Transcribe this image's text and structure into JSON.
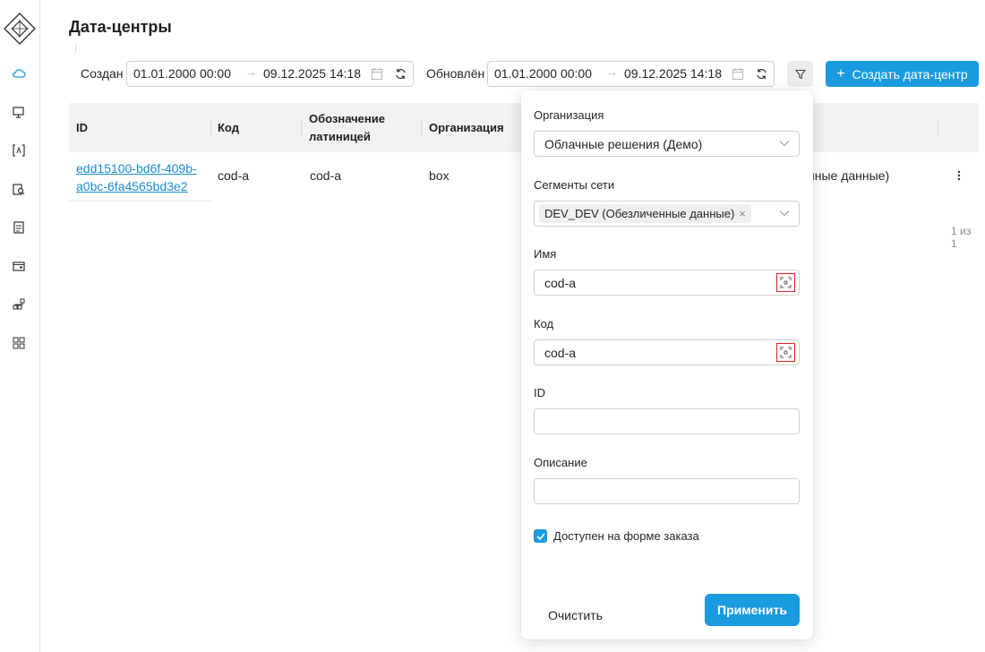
{
  "page": {
    "title": "Дата-центры"
  },
  "sidebar": {
    "icons": [
      "app-logo",
      "cloud-icon",
      "monitor-icon",
      "bracket-icon",
      "clipboard-search-icon",
      "list-icon",
      "wallet-icon",
      "hierarchy-icon",
      "grid-icon"
    ]
  },
  "filters": {
    "created_label": "Создан",
    "created_from": "01.01.2000 00:00",
    "created_to": "09.12.2025 14:18",
    "updated_label": "Обновлён",
    "updated_from": "01.01.2000 00:00",
    "updated_to": "09.12.2025 14:18",
    "arrow": "→"
  },
  "toolbar": {
    "create_label": "Создать дата-центр",
    "plus": "+"
  },
  "table": {
    "headers": {
      "id": "ID",
      "code": "Код",
      "latin": "Обозначение латиницей",
      "org": "Организация"
    },
    "rows": [
      {
        "id": "edd15100-bd6f-409b-a0bc-6fa4565bd3e2",
        "code": "cod-a",
        "latin": "cod-a",
        "org": "box",
        "segment_tail": "нные данные)"
      }
    ],
    "pager": "1 из 1"
  },
  "popup": {
    "org_label": "Организация",
    "org_value": "Облачные решения (Демо)",
    "segments_label": "Сегменты сети",
    "segment_tag": "DEV_DEV (Обезличенные данные)",
    "tag_close": "×",
    "name_label": "Имя",
    "name_value": "cod-a",
    "code_label": "Код",
    "code_value": "cod-a",
    "id_label": "ID",
    "id_value": "",
    "desc_label": "Описание",
    "desc_value": "",
    "order_form_label": "Доступен на форме заказа",
    "order_form_checked": true,
    "clear_label": "Очистить",
    "apply_label": "Применить"
  },
  "colors": {
    "accent": "#1a9be0",
    "link": "#1a8ccf",
    "highlight": "#e02020"
  }
}
